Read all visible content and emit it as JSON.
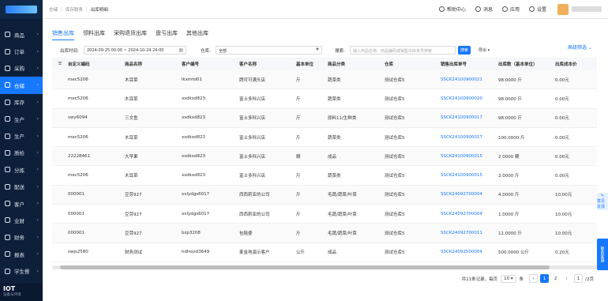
{
  "sidebar": {
    "items": [
      {
        "label": "商品",
        "active": false
      },
      {
        "label": "订单",
        "active": false
      },
      {
        "label": "采购",
        "active": false
      },
      {
        "label": "仓储",
        "active": true
      },
      {
        "label": "库存",
        "active": false
      },
      {
        "label": "生产",
        "active": false
      },
      {
        "label": "生产",
        "active": false
      },
      {
        "label": "质检",
        "active": false
      },
      {
        "label": "分拣",
        "active": false
      },
      {
        "label": "配送",
        "active": false
      },
      {
        "label": "客户",
        "active": false
      },
      {
        "label": "业财",
        "active": false
      },
      {
        "label": "财务",
        "active": false
      },
      {
        "label": "报表",
        "active": false
      },
      {
        "label": "学生餐",
        "active": false
      }
    ],
    "footer_title": "IOT",
    "footer_sub": "设备与环境"
  },
  "header": {
    "breadcrumb": [
      "仓储",
      "库存联表",
      "出库明细"
    ],
    "help": "帮助中心",
    "messages": "消息",
    "apps": "应用",
    "settings": "设置"
  },
  "tabs": [
    "销售出库",
    "领料出库",
    "采购退货出库",
    "盘亏出库",
    "其他出库"
  ],
  "advanced_filter": "高级筛选",
  "filters": {
    "time_label": "出库时间:",
    "time_value": "2024-09-25 00:00 ~ 2024-10-24 24:00",
    "warehouse_label": "仓库:",
    "warehouse_value": "全部",
    "search_label": "搜索:",
    "search_placeholder": "输入商品名称、商品编码或销售出库单号搜索",
    "search_button": "搜索",
    "export_button": "导出"
  },
  "table": {
    "columns": [
      "自定义编码",
      "商品名称",
      "客户编号",
      "客户名称",
      "基本单位",
      "商品分类",
      "仓库",
      "销售出库单号",
      "出库数（基本单位）",
      "出库成本价"
    ],
    "rows": [
      [
        "mec5206",
        "木耳菜",
        "lkxmtd01",
        "牌可可满头店",
        "斤",
        "蔬菜类",
        "测试仓库5",
        "SSCK24100900021",
        "98.0000 斤",
        "0.00元"
      ],
      [
        "mec5206",
        "木耳菜",
        "xsdkxd823",
        "富士多科兴店",
        "斤",
        "蔬菜类",
        "测试仓库5",
        "SSCK24100900020",
        "98.0000 斤",
        "0.00元"
      ],
      [
        "swy6094",
        "三文鱼",
        "xsdkxd823",
        "富士多科兴店",
        "斤",
        "原料11/生鲜类",
        "测试仓库5",
        "SSCK24100900017",
        "98.0000 斤",
        "0.00元"
      ],
      [
        "mec5206",
        "木耳菜",
        "xsdkxd823",
        "富士多科兴店",
        "斤",
        "蔬菜类",
        "测试仓库5",
        "SSCK24100900017",
        "100.0000 斤",
        "0.00元"
      ],
      [
        "22228461",
        "大苹果",
        "xsdkxd823",
        "富士多科兴店",
        "颗",
        "成品",
        "测试仓库5",
        "SSCK24100900015",
        "2.0000 颗",
        "0.00元"
      ],
      [
        "mec5206",
        "木耳菜",
        "xsdkxd823",
        "富士多科兴店",
        "斤",
        "蔬菜类",
        "测试仓库5",
        "SSCK24100900015",
        "2.0000 斤",
        "0.00元"
      ],
      [
        "000001",
        "豆芽927",
        "xxlydgs6017",
        "西西莉亚的公司",
        "斤",
        "毛蔬/蔬菜/叶菜",
        "测试仓库5",
        "SSCK24092700004",
        "4.0000 斤",
        "10.00元"
      ],
      [
        "000001",
        "豆芽927",
        "xxlydgs6017",
        "西西莉亚的公司",
        "斤",
        "毛蔬/蔬菜/叶菜",
        "测试仓库5",
        "SSCK24092700004",
        "1.0000 斤",
        "10.00元"
      ],
      [
        "000001",
        "豆芽927",
        "bzp3208",
        "包租婆",
        "斤",
        "毛蔬/蔬菜/叶菜",
        "测试仓库5",
        "SSCK24092700011",
        "11.0000 斤",
        "10.00元"
      ],
      [
        "swjs2580",
        "财务测试",
        "hdlnszd3649",
        "麦金地演示客户",
        "公斤",
        "成品",
        "测试仓库5",
        "SSCK24092500004",
        "500.0000 公斤",
        "0.20元"
      ]
    ]
  },
  "pagination": {
    "total": "共11条记录，每页",
    "page_size": "10",
    "unit": "条",
    "pages": [
      "1",
      "2"
    ],
    "current": "1",
    "goto_value": "1",
    "goto_suffix": "/2页"
  },
  "side_tabs": {
    "feedback": "意见反馈",
    "service": "联系客服"
  }
}
